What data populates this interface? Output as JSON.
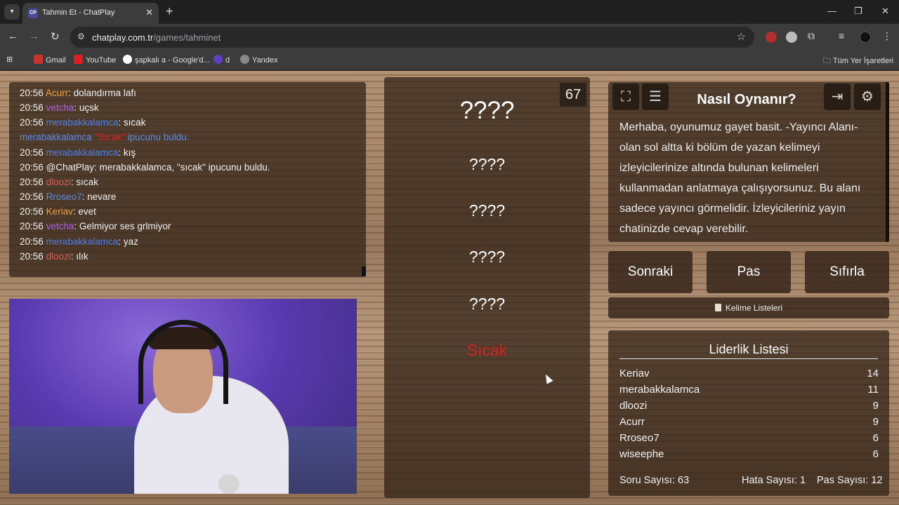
{
  "browser": {
    "tab_title": "Tahmin Et - ChatPlay",
    "tab_favicon": "CP",
    "url_host": "chatplay.com.tr",
    "url_path": "/games/tahminet",
    "bookmarks": [
      "Gmail",
      "YouTube",
      "şapkalı a - Google'd...",
      "d",
      "Yandex"
    ],
    "all_bookmarks": "Tüm Yer İşaretleri"
  },
  "chat": {
    "messages": [
      {
        "time": "20:56",
        "user": "Acurr",
        "sep": ": ",
        "text": "dolandırma lafı"
      },
      {
        "time": "20:56",
        "user": "vetcha",
        "sep": ": ",
        "text": "uçsk"
      },
      {
        "time": "20:56",
        "user": "merabakkalamca",
        "sep": ": ",
        "text": "sıcak"
      },
      {
        "user": "merabakkalamca",
        "hint": "\"Sıcak\"",
        "text": " ipucunu buldu."
      },
      {
        "time": "20:56",
        "user": "merabakkalamca",
        "sep": ": ",
        "text": "kış"
      },
      {
        "time": "20:56",
        "text": "@ChatPlay: merabakkalamca, \"sıcak\" ipucunu buldu."
      },
      {
        "time": "20:56",
        "user": "dloozi",
        "sep": ": ",
        "text": "sıcak"
      },
      {
        "time": "20:56",
        "user": "Rroseo7",
        "sep": ": ",
        "text": "nevare"
      },
      {
        "time": "20:56",
        "user": "Keriav",
        "sep": ": ",
        "text": "evet"
      },
      {
        "time": "20:56",
        "user": "vetcha",
        "sep": ": ",
        "text": "Gelmiyor ses grlmiyor"
      },
      {
        "time": "20:56",
        "user": "merabakkalamca",
        "sep": ": ",
        "text": "yaz"
      },
      {
        "time": "20:56",
        "user": "dloozi",
        "sep": ": ",
        "text": "ılık"
      }
    ]
  },
  "game": {
    "timer": "67",
    "main_word": "????",
    "hints": [
      "????",
      "????",
      "????",
      "????",
      "Sıcak"
    ]
  },
  "howto": {
    "title": "Nasıl Oynanır?",
    "text": "Merhaba, oyunumuz gayet basit. -Yayıncı Alanı- olan sol altta ki bölüm de yazan kelimeyi izleyicilerinize altında bulunan kelimeleri kullanmadan anlatmaya çalışıyorsunuz. Bu alanı sadece yayıncı görmelidir. İzleyicileriniz yayın chatinizde cevap verebilir."
  },
  "actions": {
    "next": "Sonraki",
    "pass": "Pas",
    "reset": "Sıfırla",
    "word_lists": "Kelime Listeleri"
  },
  "leaderboard": {
    "title": "Liderlik Listesi",
    "rows": [
      {
        "name": "Keriav",
        "score": "14"
      },
      {
        "name": "merabakkalamca",
        "score": "11"
      },
      {
        "name": "dloozi",
        "score": "9"
      },
      {
        "name": "Acurr",
        "score": "9"
      },
      {
        "name": "Rroseo7",
        "score": "6"
      },
      {
        "name": "wiseephe",
        "score": "6"
      }
    ],
    "stats": {
      "questions": "Soru Sayısı: 63",
      "errors": "Hata Sayısı: 1",
      "passes": "Pas Sayısı: 12"
    }
  },
  "colors": {
    "hint_red": "#d32020",
    "panel": "#2d1e14"
  }
}
